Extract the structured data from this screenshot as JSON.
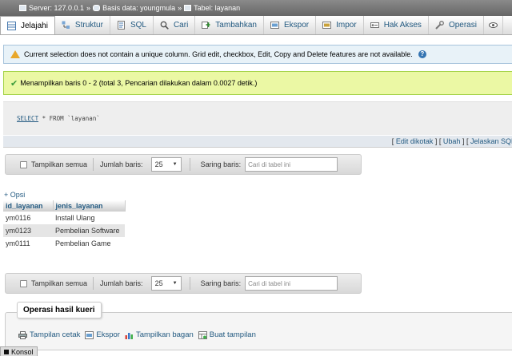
{
  "breadcrumb": {
    "server": "Server: 127.0.0.1",
    "database": "Basis data: youngmula",
    "table": "Tabel: layanan",
    "separator": "»"
  },
  "tabs": [
    {
      "label": "Jelajahi",
      "icon": "browse-icon"
    },
    {
      "label": "Struktur",
      "icon": "structure-icon"
    },
    {
      "label": "SQL",
      "icon": "sql-icon"
    },
    {
      "label": "Cari",
      "icon": "search-icon"
    },
    {
      "label": "Tambahkan",
      "icon": "insert-icon"
    },
    {
      "label": "Ekspor",
      "icon": "export-icon"
    },
    {
      "label": "Impor",
      "icon": "import-icon"
    },
    {
      "label": "Hak Akses",
      "icon": "privileges-icon"
    },
    {
      "label": "Operasi",
      "icon": "operations-icon"
    }
  ],
  "notice": {
    "text": "Current selection does not contain a unique column. Grid edit, checkbox, Edit, Copy and Delete features are not available.",
    "help": "?"
  },
  "success": {
    "text": "Menampilkan baris 0 - 2 (total 3, Pencarian dilakukan dalam 0.0027 detik.)"
  },
  "sql": {
    "keyword": "SELECT",
    "rest": " * FROM `layanan`"
  },
  "sql_links": {
    "open": "[",
    "edit_inline": "Edit dikotak",
    "sep1": "] [",
    "edit": "Ubah",
    "sep2": "] [",
    "explain": "Jelaskan SQL"
  },
  "nav": {
    "show_all": "Tampilkan semua",
    "rows_label": "Jumlah baris:",
    "rows_value": "25",
    "filter_label": "Saring baris:",
    "filter_placeholder": "Cari di tabel ini"
  },
  "results": {
    "options_link": "+ Opsi",
    "columns": [
      "id_layanan",
      "jenis_layanan"
    ],
    "rows": [
      [
        "ym0116",
        "Install Ulang"
      ],
      [
        "ym0123",
        "Pembelian Software"
      ],
      [
        "ym0111",
        "Pembelian Game"
      ]
    ]
  },
  "query_ops": {
    "legend": "Operasi hasil kueri",
    "links": [
      {
        "label": "Tampilan cetak",
        "icon": "print-icon"
      },
      {
        "label": "Ekspor",
        "icon": "export-icon"
      },
      {
        "label": "Tampilkan bagan",
        "icon": "chart-icon"
      },
      {
        "label": "Buat tampilan",
        "icon": "view-icon"
      }
    ]
  },
  "console": {
    "label": "Konsol"
  },
  "colors": {
    "link": "#235a81",
    "success_bg": "#ebf8a4",
    "notice_bg": "#e8f2f8"
  }
}
